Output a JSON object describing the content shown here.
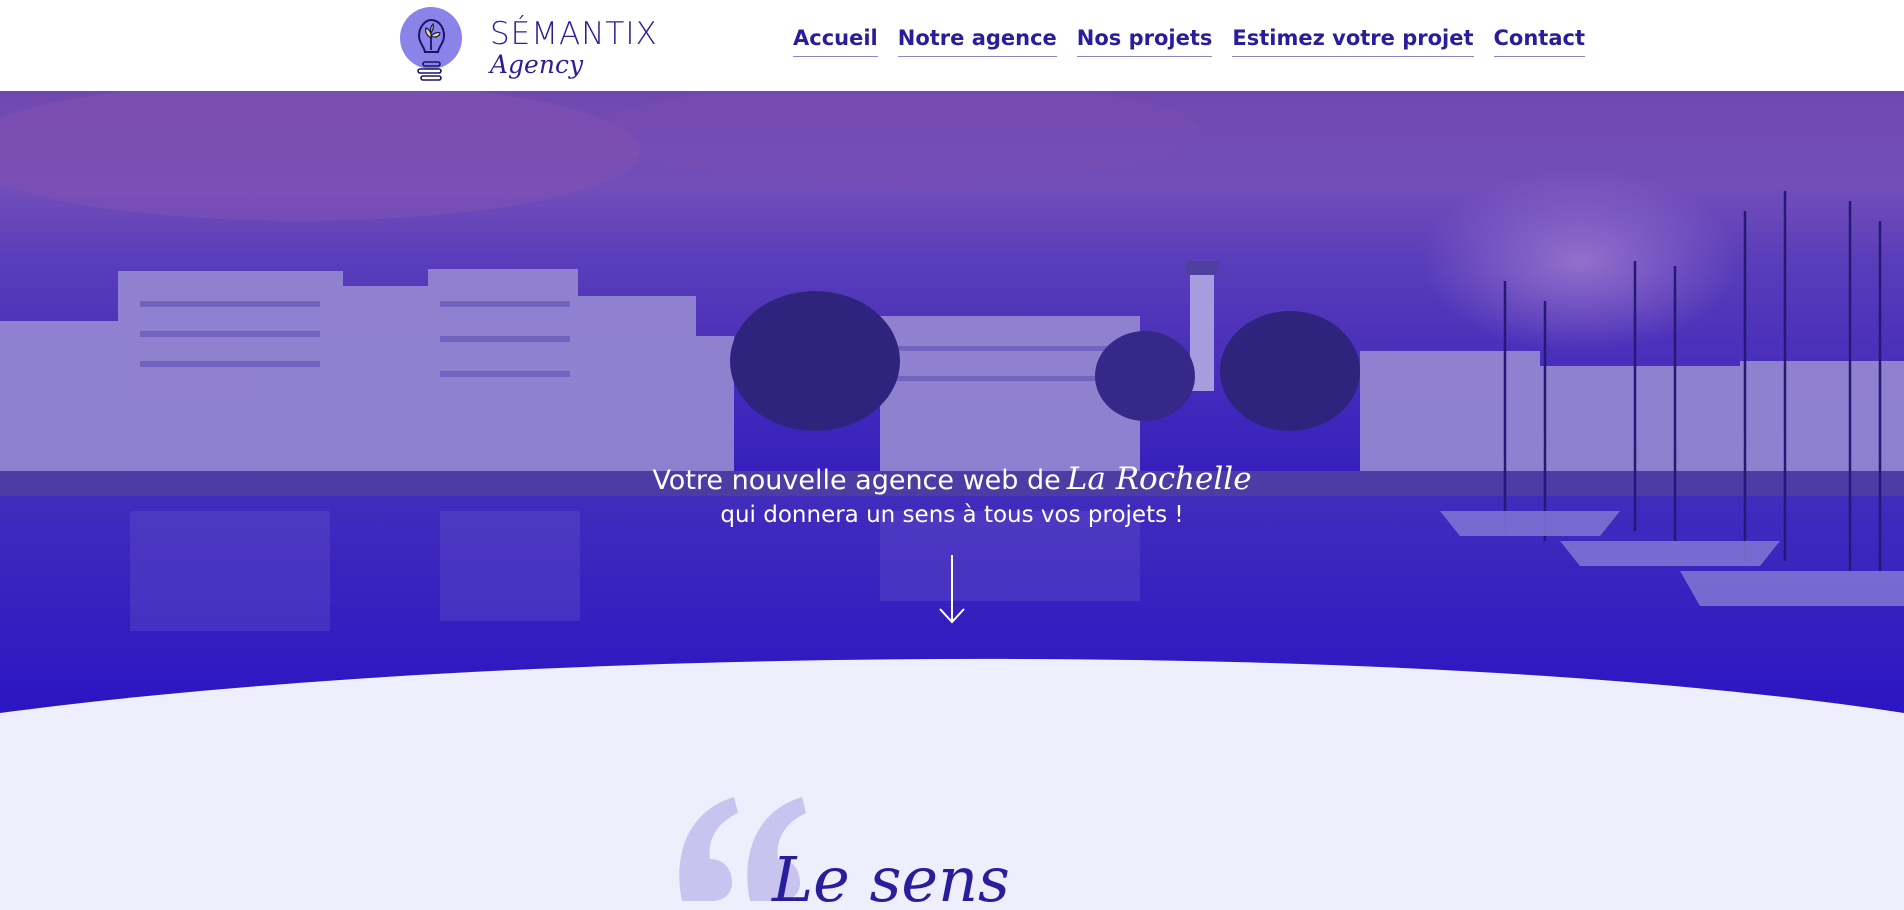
{
  "brand": {
    "name": "SÉMANTIX",
    "tagline": "Agency",
    "logo_icon": "lightbulb-sprout-icon",
    "primary_color": "#2a1d9c",
    "logo_circle_color": "#8a83e8"
  },
  "nav": {
    "items": [
      {
        "label": "Accueil"
      },
      {
        "label": "Notre agence"
      },
      {
        "label": "Nos projets"
      },
      {
        "label": "Estimez votre projet"
      },
      {
        "label": "Contact"
      }
    ]
  },
  "hero": {
    "line1_text": "Votre nouvelle agence web de",
    "line1_highlight": "La Rochelle",
    "line2_text": "qui donnera un sens à tous vos projets !",
    "scroll_icon": "arrow-down-icon",
    "overlay_color": "#2f18c8"
  },
  "quote_section": {
    "quote_icon": "quote-mark-icon",
    "title": "Le sens"
  }
}
